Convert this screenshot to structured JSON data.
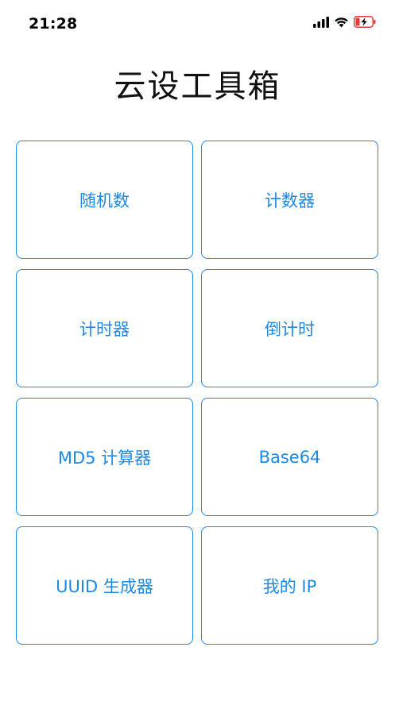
{
  "status_bar": {
    "time": "21:28",
    "icons": [
      "signal-icon",
      "wifi-icon",
      "battery-charging-icon"
    ],
    "battery_color": "#E53935"
  },
  "title": "云设工具箱",
  "tools": [
    {
      "label": "随机数"
    },
    {
      "label": "计数器"
    },
    {
      "label": "计时器"
    },
    {
      "label": "倒计时"
    },
    {
      "label": "MD5 计算器"
    },
    {
      "label": "Base64"
    },
    {
      "label": "UUID 生成器"
    },
    {
      "label": "我的 IP"
    }
  ],
  "colors": {
    "accent": "#1E88E5",
    "title": "#111111",
    "background": "#FFFFFF"
  }
}
